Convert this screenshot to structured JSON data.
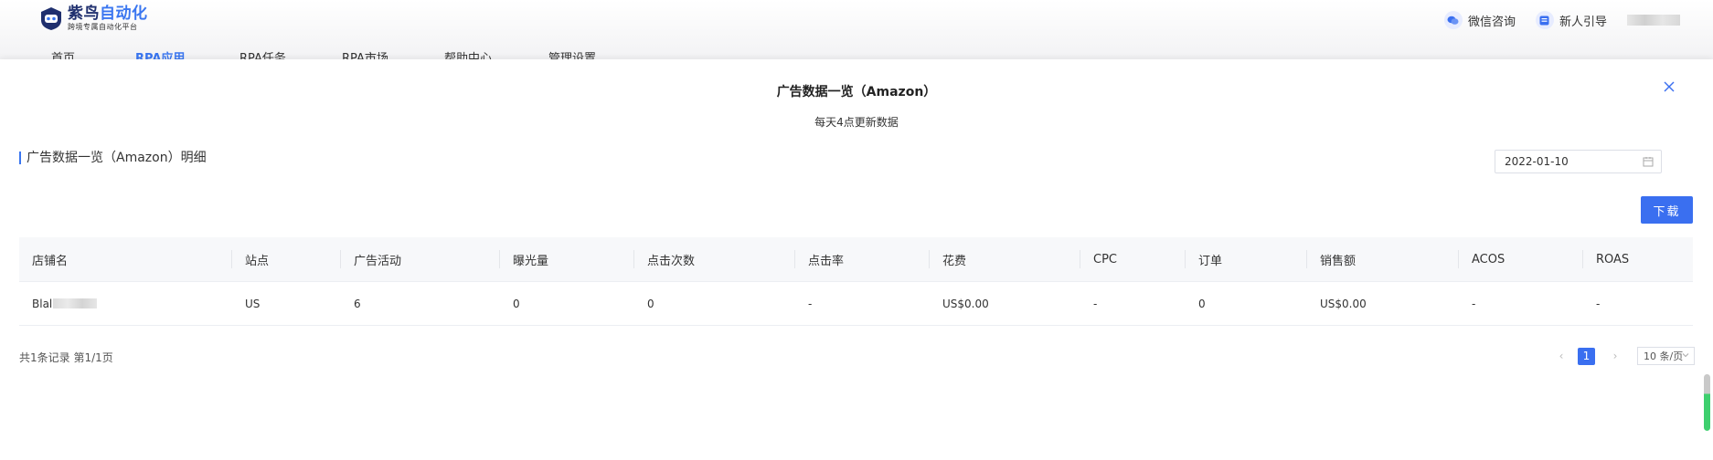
{
  "app": {
    "logo_title_a": "紫鸟",
    "logo_title_b": "自动化",
    "logo_subtitle": "跨境专属自动化平台"
  },
  "header": {
    "wechat_label": "微信咨询",
    "guide_label": "新人引导"
  },
  "nav": {
    "items": [
      "首页",
      "RPA应用",
      "RPA任务",
      "RPA市场",
      "帮助中心",
      "管理设置"
    ]
  },
  "modal": {
    "title": "广告数据一览（Amazon）",
    "subtitle": "每天4点更新数据",
    "section_title": "广告数据一览（Amazon）明细",
    "date_value": "2022-01-10",
    "download_label": "下载"
  },
  "table": {
    "columns": [
      "店铺名",
      "站点",
      "广告活动",
      "曝光量",
      "点击次数",
      "点击率",
      "花费",
      "CPC",
      "订单",
      "销售额",
      "ACOS",
      "ROAS"
    ],
    "rows": [
      [
        "Blal",
        "US",
        "6",
        "0",
        "0",
        "-",
        "US$0.00",
        "-",
        "0",
        "US$0.00",
        "-",
        "-"
      ]
    ]
  },
  "pagination": {
    "summary": "共1条记录 第1/1页",
    "prev": "‹",
    "current_page": "1",
    "next": "›",
    "page_size": "10 条/页"
  },
  "colors": {
    "accent": "#3a6ff0",
    "scroll_indicator": "#3ecf6e"
  }
}
